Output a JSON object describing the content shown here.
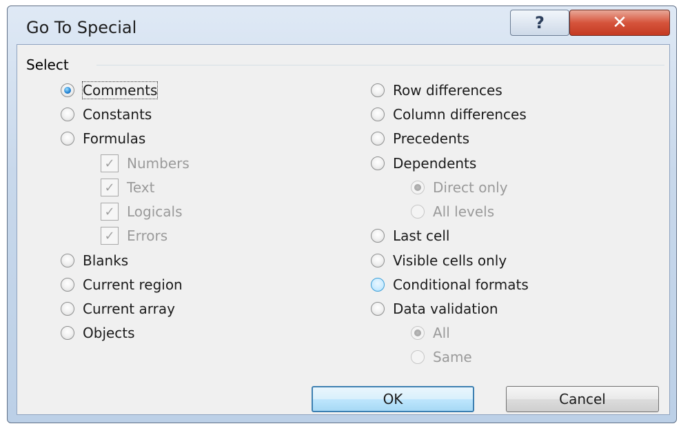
{
  "window": {
    "title": "Go To Special",
    "help_glyph": "?",
    "close_glyph": "✕"
  },
  "group": {
    "label": "Select"
  },
  "left_options": [
    {
      "label": "Comments",
      "type": "radio",
      "selected": true,
      "disabled": false
    },
    {
      "label": "Constants",
      "type": "radio",
      "selected": false,
      "disabled": false
    },
    {
      "label": "Formulas",
      "type": "radio",
      "selected": false,
      "disabled": false
    },
    {
      "label": "Numbers",
      "type": "checkbox",
      "checked": true,
      "disabled": true
    },
    {
      "label": "Text",
      "type": "checkbox",
      "checked": true,
      "disabled": true
    },
    {
      "label": "Logicals",
      "type": "checkbox",
      "checked": true,
      "disabled": true
    },
    {
      "label": "Errors",
      "type": "checkbox",
      "checked": true,
      "disabled": true
    },
    {
      "label": "Blanks",
      "type": "radio",
      "selected": false,
      "disabled": false
    },
    {
      "label": "Current region",
      "type": "radio",
      "selected": false,
      "disabled": false
    },
    {
      "label": "Current array",
      "type": "radio",
      "selected": false,
      "disabled": false
    },
    {
      "label": "Objects",
      "type": "radio",
      "selected": false,
      "disabled": false
    }
  ],
  "right_options": [
    {
      "label": "Row differences",
      "type": "radio",
      "selected": false,
      "disabled": false
    },
    {
      "label": "Column differences",
      "type": "radio",
      "selected": false,
      "disabled": false
    },
    {
      "label": "Precedents",
      "type": "radio",
      "selected": false,
      "disabled": false
    },
    {
      "label": "Dependents",
      "type": "radio",
      "selected": false,
      "disabled": false
    },
    {
      "label": "Direct only",
      "type": "radio",
      "selected": true,
      "disabled": true
    },
    {
      "label": "All levels",
      "type": "radio",
      "selected": false,
      "disabled": true
    },
    {
      "label": "Last cell",
      "type": "radio",
      "selected": false,
      "disabled": false
    },
    {
      "label": "Visible cells only",
      "type": "radio",
      "selected": false,
      "disabled": false
    },
    {
      "label": "Conditional formats",
      "type": "radio",
      "selected": false,
      "disabled": false,
      "hover": true
    },
    {
      "label": "Data validation",
      "type": "radio",
      "selected": false,
      "disabled": false
    },
    {
      "label": "All",
      "type": "radio",
      "selected": true,
      "disabled": true
    },
    {
      "label": "Same",
      "type": "radio",
      "selected": false,
      "disabled": true
    }
  ],
  "buttons": {
    "ok": "OK",
    "cancel": "Cancel"
  },
  "colors": {
    "accent": "#1f7fd1",
    "close_red": "#c43a22",
    "dialog_bg": "#f0f0f0"
  }
}
